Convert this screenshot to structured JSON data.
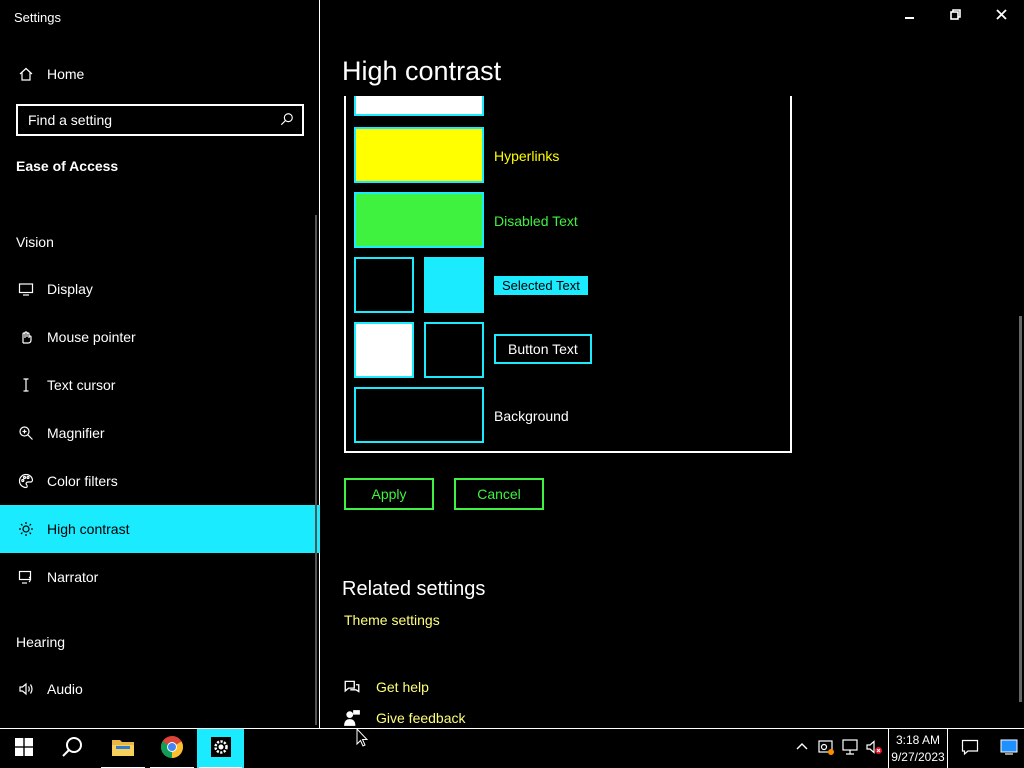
{
  "window": {
    "app_title": "Settings",
    "controls": [
      "minimize-icon",
      "restore-icon",
      "close-icon"
    ]
  },
  "sidebar": {
    "home_label": "Home",
    "search_placeholder": "Find a setting",
    "category": "Ease of Access",
    "vision_heading": "Vision",
    "hearing_heading": "Hearing",
    "items": [
      {
        "label": "Display",
        "icon": "display-icon"
      },
      {
        "label": "Mouse pointer",
        "icon": "mouse-pointer-icon"
      },
      {
        "label": "Text cursor",
        "icon": "text-cursor-icon"
      },
      {
        "label": "Magnifier",
        "icon": "magnifier-icon"
      },
      {
        "label": "Color filters",
        "icon": "color-filters-icon"
      },
      {
        "label": "High contrast",
        "icon": "brightness-icon",
        "active": true
      },
      {
        "label": "Narrator",
        "icon": "narrator-icon"
      },
      {
        "label": "Audio",
        "icon": "audio-icon"
      }
    ]
  },
  "main": {
    "title": "High contrast",
    "preview": {
      "hyperlinks_label": "Hyperlinks",
      "disabled_text_label": "Disabled Text",
      "selected_text_label": "Selected Text",
      "button_text_label": "Button Text",
      "background_label": "Background"
    },
    "apply_label": "Apply",
    "cancel_label": "Cancel",
    "related_title": "Related settings",
    "theme_settings_link": "Theme settings",
    "get_help": "Get help",
    "give_feedback": "Give feedback"
  },
  "colors": {
    "accent": "#1aebff",
    "hyperlink": "#ffff00",
    "disabled_text": "#3ff23f",
    "link_text": "#ffff7a",
    "background": "#000000",
    "foreground": "#ffffff"
  },
  "taskbar": {
    "apps": [
      "start-icon",
      "search-icon",
      "file-explorer-icon",
      "chrome-icon",
      "settings-icon"
    ],
    "time": "3:18 AM",
    "date": "9/27/2023"
  }
}
